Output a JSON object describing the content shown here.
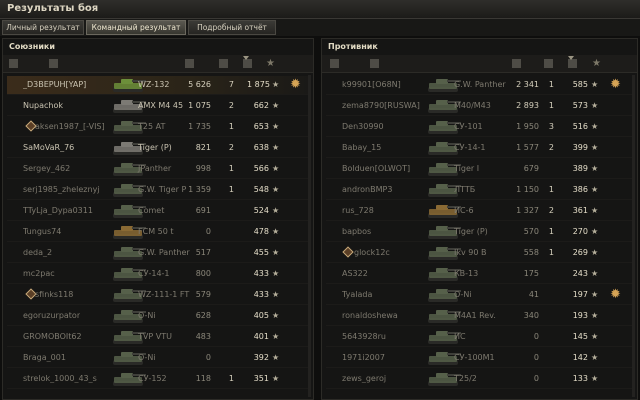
{
  "window": {
    "title": "Результаты боя"
  },
  "tabs": [
    {
      "label": "Личный результат"
    },
    {
      "label": "Командный результат"
    },
    {
      "label": "Подробный отчёт"
    }
  ],
  "allies": {
    "title": "Союзники",
    "rows": [
      {
        "player": "_D3BEPUH[YAP]",
        "vehicle": "WZ-132",
        "damage": "5 626",
        "kills": "7",
        "xp": "1 875",
        "own": true,
        "medal": true,
        "tank_color": "#6c8f3a"
      },
      {
        "player": "Nupachok",
        "vehicle": "AMX M4 45",
        "damage": "1 075",
        "kills": "2",
        "xp": "662",
        "tank_color": "#7c7a74"
      },
      {
        "player": "aksen1987_[-VIS]",
        "vehicle": "T25 AT",
        "damage": "1 735",
        "kills": "1",
        "xp": "653",
        "platoon": true,
        "dead": true,
        "tank_color": "#56604a"
      },
      {
        "player": "SaMoVaR_76",
        "vehicle": "Tiger (P)",
        "damage": "821",
        "kills": "2",
        "xp": "638",
        "tank_color": "#7c7a74"
      },
      {
        "player": "Sergey_462",
        "vehicle": "JPanther",
        "damage": "998",
        "kills": "1",
        "xp": "566",
        "dead": true,
        "tank_color": "#56604a"
      },
      {
        "player": "serj1985_zheleznyj",
        "vehicle": "G.W. Tiger P",
        "damage": "1 359",
        "kills": "1",
        "xp": "548",
        "dead": true,
        "tank_color": "#56604a"
      },
      {
        "player": "TTyLja_Dypa0311",
        "vehicle": "Comet",
        "damage": "691",
        "kills": "",
        "xp": "524",
        "dead": true,
        "tank_color": "#56604a"
      },
      {
        "player": "Tungus74",
        "vehicle": "FCM 50 t",
        "damage": "0",
        "kills": "",
        "xp": "478",
        "dead": true,
        "tank_color": "#8a6a34"
      },
      {
        "player": "deda_2",
        "vehicle": "G.W. Panther",
        "damage": "517",
        "kills": "",
        "xp": "455",
        "dead": true,
        "tank_color": "#56604a"
      },
      {
        "player": "mc2pac",
        "vehicle": "СУ-14-1",
        "damage": "800",
        "kills": "",
        "xp": "433",
        "dead": true,
        "tank_color": "#56604a"
      },
      {
        "player": "sfinks118",
        "vehicle": "WZ-111-1 FT",
        "damage": "579",
        "kills": "",
        "xp": "433",
        "platoon": true,
        "dead": true,
        "tank_color": "#56604a"
      },
      {
        "player": "egoruzurpator",
        "vehicle": "O-Ni",
        "damage": "628",
        "kills": "",
        "xp": "405",
        "dead": true,
        "tank_color": "#56604a"
      },
      {
        "player": "GROMOBOIt62",
        "vehicle": "TVP VTU",
        "damage": "483",
        "kills": "",
        "xp": "401",
        "dead": true,
        "tank_color": "#56604a"
      },
      {
        "player": "Braga_001",
        "vehicle": "O-Ni",
        "damage": "0",
        "kills": "",
        "xp": "392",
        "dead": true,
        "tank_color": "#56604a"
      },
      {
        "player": "strelok_1000_43_s",
        "vehicle": "СУ-152",
        "damage": "118",
        "kills": "1",
        "xp": "351",
        "dead": true,
        "tank_color": "#56604a"
      }
    ]
  },
  "enemies": {
    "title": "Противник",
    "rows": [
      {
        "player": "k99901[O68N]",
        "vehicle": "G.W. Panther",
        "damage": "2 341",
        "kills": "1",
        "xp": "585",
        "medal": true,
        "dead": true,
        "tank_color": "#56604a"
      },
      {
        "player": "zema8790[RUSWA]",
        "vehicle": "M40/M43",
        "damage": "2 893",
        "kills": "1",
        "xp": "573",
        "dead": true,
        "tank_color": "#56604a"
      },
      {
        "player": "Den30990",
        "vehicle": "СУ-101",
        "damage": "1 950",
        "kills": "3",
        "xp": "516",
        "dead": true,
        "tank_color": "#56604a"
      },
      {
        "player": "Babay_15",
        "vehicle": "СУ-14-1",
        "damage": "1 577",
        "kills": "2",
        "xp": "399",
        "dead": true,
        "tank_color": "#56604a"
      },
      {
        "player": "Bolduen[OLWOT]",
        "vehicle": "Tiger I",
        "damage": "679",
        "kills": "",
        "xp": "389",
        "dead": true,
        "tank_color": "#56604a"
      },
      {
        "player": "andronBMP3",
        "vehicle": "ЛТТБ",
        "damage": "1 150",
        "kills": "1",
        "xp": "386",
        "dead": true,
        "tank_color": "#56604a"
      },
      {
        "player": "rus_728",
        "vehicle": "ИС-6",
        "damage": "1 327",
        "kills": "2",
        "xp": "361",
        "dead": true,
        "tank_color": "#8a6a34"
      },
      {
        "player": "bapbos",
        "vehicle": "Tiger (P)",
        "damage": "570",
        "kills": "1",
        "xp": "270",
        "dead": true,
        "tank_color": "#56604a"
      },
      {
        "player": "glock12c",
        "vehicle": "Ikv 90 B",
        "damage": "558",
        "kills": "1",
        "xp": "269",
        "platoon": true,
        "dead": true,
        "tank_color": "#56604a"
      },
      {
        "player": "AS322",
        "vehicle": "КВ-13",
        "damage": "175",
        "kills": "",
        "xp": "243",
        "dead": true,
        "tank_color": "#56604a"
      },
      {
        "player": "Tyalada",
        "vehicle": "O-Ni",
        "damage": "41",
        "kills": "",
        "xp": "197",
        "medal": true,
        "dead": true,
        "tank_color": "#56604a"
      },
      {
        "player": "ronaldoshewa",
        "vehicle": "M4A1 Rev.",
        "damage": "340",
        "kills": "",
        "xp": "193",
        "dead": true,
        "tank_color": "#56604a"
      },
      {
        "player": "5643928ru",
        "vehicle": "ИС",
        "damage": "0",
        "kills": "",
        "xp": "145",
        "dead": true,
        "tank_color": "#56604a"
      },
      {
        "player": "1971i2007",
        "vehicle": "СУ-100М1",
        "damage": "0",
        "kills": "",
        "xp": "142",
        "dead": true,
        "tank_color": "#56604a"
      },
      {
        "player": "zews_geroj",
        "vehicle": "T25/2",
        "damage": "0",
        "kills": "",
        "xp": "133",
        "dead": true,
        "tank_color": "#56604a"
      }
    ]
  },
  "icons": {
    "star": "★",
    "medal": "✹",
    "header_columns": [
      "vehicle-icon",
      "player-icon",
      "tank-icon",
      "damage-icon",
      "kills-icon",
      "xp-icon"
    ]
  }
}
